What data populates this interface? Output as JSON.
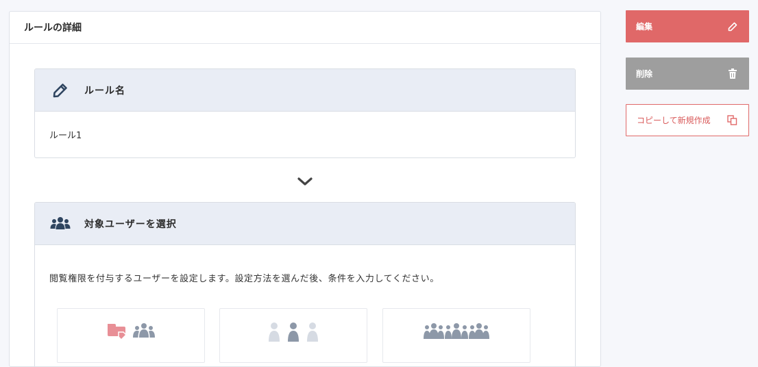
{
  "card": {
    "title": "ルールの詳細"
  },
  "rule_name_section": {
    "title": "ルール名",
    "icon": "pencil-icon",
    "value": "ルール1"
  },
  "target_users_section": {
    "title": "対象ユーザーを選択",
    "icon": "users-icon",
    "description": "閲覧権限を付与するユーザーを設定します。設定方法を選んだ後、条件を入力してください。",
    "methods": [
      {
        "icon": "tag-users-icon"
      },
      {
        "icon": "individual-user-icon"
      },
      {
        "icon": "all-users-icon"
      }
    ]
  },
  "actions": {
    "edit_label": "編集",
    "delete_label": "削除",
    "copy_label": "コピーして新規作成"
  },
  "colors": {
    "accent": "#e06868",
    "delete_bg": "#9e9e9e",
    "header_bg": "#e9edf5",
    "icon_navy": "#2f4560",
    "icon_gray": "#8d98a8",
    "icon_pink": "#e88f96",
    "icon_light": "#d6dbe3"
  }
}
